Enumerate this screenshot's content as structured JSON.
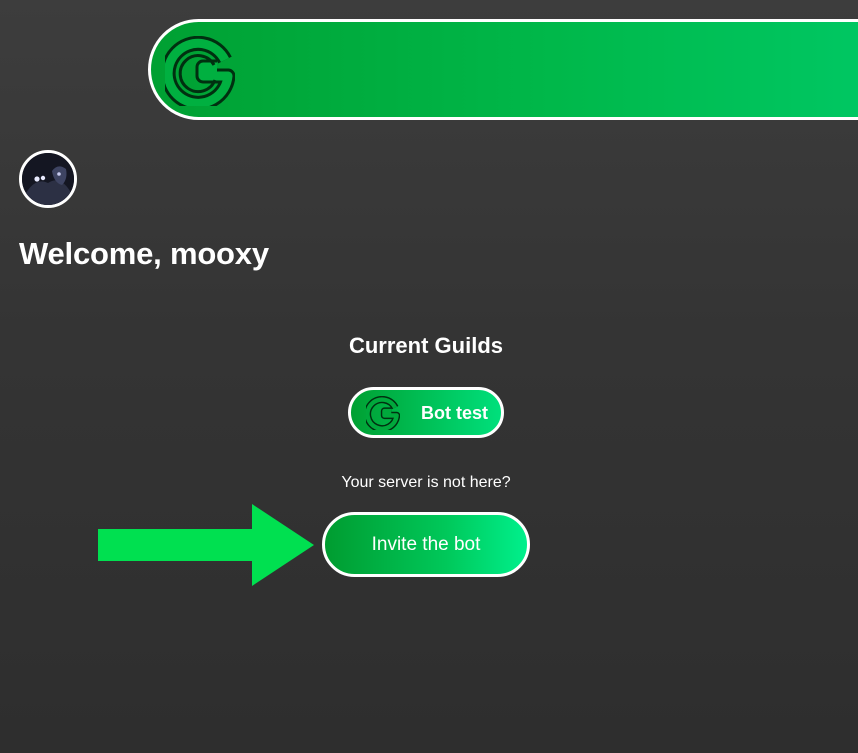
{
  "header": {
    "logo_icon": "g-logo-icon",
    "background_color": "#00b84a"
  },
  "user": {
    "avatar_icon": "user-avatar",
    "welcome_text": "Welcome, mooxy"
  },
  "guilds": {
    "title": "Current Guilds",
    "items": [
      {
        "icon": "g-logo-icon",
        "label": "Bot test"
      }
    ]
  },
  "invite": {
    "hint": "Your server is not here?",
    "button_label": "Invite the bot",
    "arrow_icon": "arrow-right-icon",
    "arrow_color": "#00e050"
  },
  "colors": {
    "accent_green": "#00b84a",
    "background": "#353535",
    "text": "#ffffff"
  }
}
